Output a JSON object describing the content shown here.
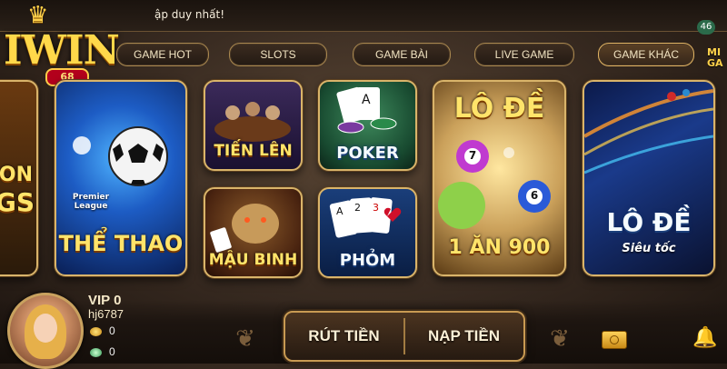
{
  "ticker": {
    "text": "ập duy nhất!"
  },
  "logo": {
    "word": "IWIN",
    "sub": "68"
  },
  "tabs": [
    {
      "label": "GAME HOT"
    },
    {
      "label": "SLOTS"
    },
    {
      "label": "GAME BÀI"
    },
    {
      "label": "LIVE GAME"
    },
    {
      "label": "GAME KHÁC"
    }
  ],
  "event": {
    "number": "46",
    "text": "MI GA"
  },
  "games": {
    "left_partial": {
      "line1": "ON",
      "line2": "GS"
    },
    "the_thao": {
      "label": "THỂ THAO",
      "league": "Premier League"
    },
    "tien_len": {
      "label": "TIẾN LÊN"
    },
    "poker": {
      "label": "POKER"
    },
    "mau_binh": {
      "label": "MẬU BINH"
    },
    "phom": {
      "label": "PHỎM"
    },
    "lo_de": {
      "title": "LÔ ĐỀ",
      "subtitle": "1 ĂN 900",
      "ball1": "7",
      "ball2": "6"
    },
    "lo_de_sieu_toc": {
      "title": "LÔ ĐỀ",
      "subtitle": "Siêu tốc"
    }
  },
  "user": {
    "vip": "VIP 0",
    "username": "hj6787",
    "gold_balance": "0",
    "silver_balance": "0"
  },
  "actions": {
    "withdraw": "RÚT TIỀN",
    "deposit": "NẠP TIỀN"
  },
  "colors": {
    "gold": "#ffd24a",
    "border": "#d9b46a",
    "background": "#3a2c22"
  }
}
